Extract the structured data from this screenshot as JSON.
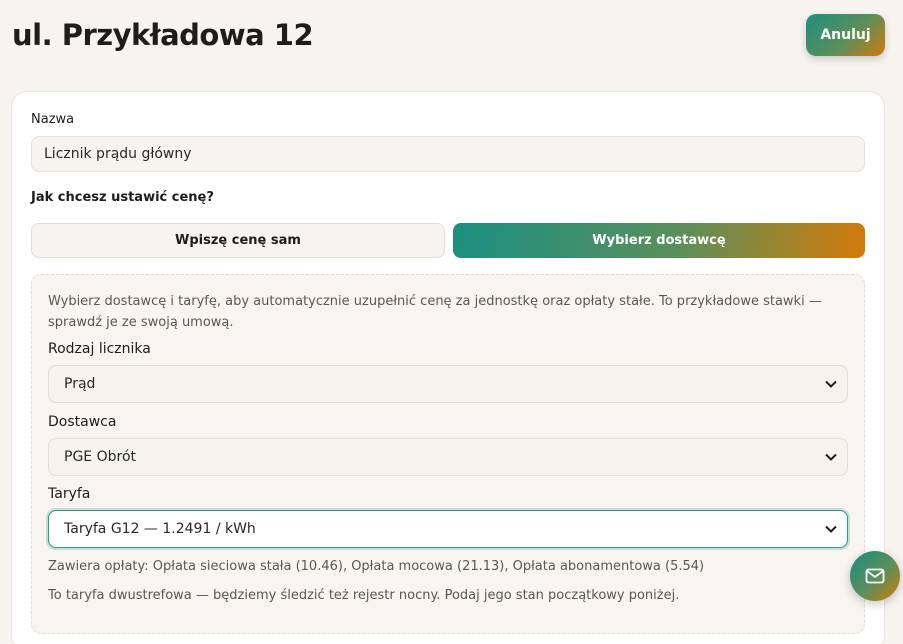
{
  "header": {
    "title": "ul. Przykładowa 12",
    "cancel_label": "Anuluj"
  },
  "form": {
    "name_label": "Nazwa",
    "name_value": "Licznik prądu główny",
    "price_question": "Jak chcesz ustawić cenę?",
    "mode_manual_label": "Wpiszę cenę sam",
    "mode_provider_label": "Wybierz dostawcę",
    "selected_mode": "provider"
  },
  "provider_panel": {
    "hint": "Wybierz dostawcę i taryfę, aby automatycznie uzupełnić cenę za jednostkę oraz opłaty stałe. To przykładowe stawki — sprawdź je ze swoją umową.",
    "meter_type_label": "Rodzaj licznika",
    "meter_type_value": "Prąd",
    "provider_label": "Dostawca",
    "provider_value": "PGE Obrót",
    "tariff_label": "Taryfa",
    "tariff_value": "Taryfa G12 — 1.2491 / kWh",
    "fees_note": "Zawiera opłaty: Opłata sieciowa stała (10.46), Opłata mocowa (21.13), Opłata abonamentowa (5.54)",
    "dual_zone_note": "To taryfa dwustrefowa — będziemy śledzić też rejestr nocny. Podaj jego stan początkowy poniżej."
  },
  "fab": {
    "icon": "mail-icon"
  },
  "colors": {
    "background": "#f7f4ef",
    "accent_start": "#1a8f82",
    "accent_end": "#d57a0a",
    "focus": "#2a9a8a"
  }
}
